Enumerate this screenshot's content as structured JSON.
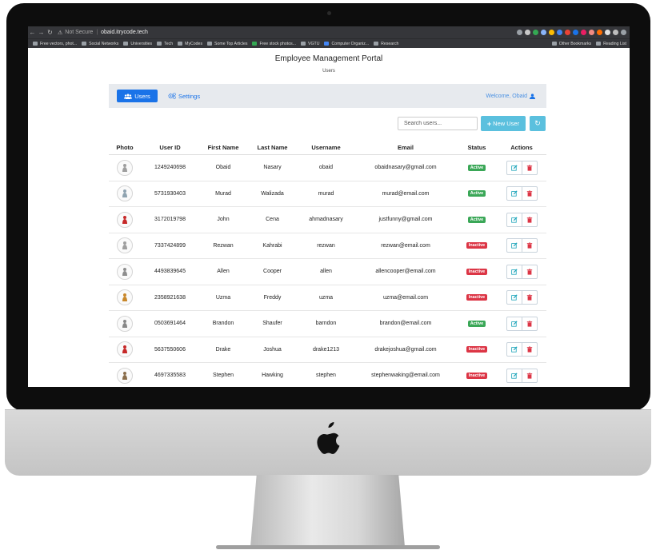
{
  "browser": {
    "not_secure": "Not Secure",
    "url": "obaid.itrycode.tech",
    "bookmarks": [
      "Free vectors, phot...",
      "Social Networks",
      "Universities",
      "Tech",
      "MyCodes",
      "Some Top Articles",
      "Free stock photos...",
      "VGTU",
      "Computer Organiz...",
      "Research"
    ],
    "bookmarks_right": [
      "Other Bookmarks",
      "Reading List"
    ]
  },
  "page": {
    "title": "Employee Management Portal",
    "subtitle": "Users"
  },
  "nav": {
    "users_label": "Users",
    "settings_label": "Settings",
    "welcome": "Welcome, Obaid"
  },
  "toolbar": {
    "search_placeholder": "Search users...",
    "new_user_label": "New User"
  },
  "table": {
    "headers": [
      "Photo",
      "User ID",
      "First Name",
      "Last Name",
      "Username",
      "Email",
      "Status",
      "Actions"
    ],
    "rows": [
      {
        "id": "1249240698",
        "first": "Obaid",
        "last": "Nasary",
        "username": "obaid",
        "email": "obaidnasary@gmail.com",
        "status": "Active"
      },
      {
        "id": "5731930403",
        "first": "Murad",
        "last": "Walizada",
        "username": "murad",
        "email": "murad@email.com",
        "status": "Active"
      },
      {
        "id": "3172019798",
        "first": "John",
        "last": "Cena",
        "username": "ahmadnasary",
        "email": "justfunny@gmail.com",
        "status": "Active"
      },
      {
        "id": "7337424899",
        "first": "Rezwan",
        "last": "Kahrabi",
        "username": "rezwan",
        "email": "rezwan@email.com",
        "status": "Inactive"
      },
      {
        "id": "4493839645",
        "first": "Allen",
        "last": "Cooper",
        "username": "allen",
        "email": "allencooper@email.com",
        "status": "Inactive"
      },
      {
        "id": "2358921638",
        "first": "Uzma",
        "last": "Freddy",
        "username": "uzma",
        "email": "uzma@email.com",
        "status": "Inactive"
      },
      {
        "id": "0503691464",
        "first": "Brandon",
        "last": "Shaufer",
        "username": "barndon",
        "email": "brandon@email.com",
        "status": "Active"
      },
      {
        "id": "5637550606",
        "first": "Drake",
        "last": "Joshua",
        "username": "drake1213",
        "email": "drakejoshua@gmail.com",
        "status": "Inactive"
      },
      {
        "id": "4697335583",
        "first": "Stephen",
        "last": "Hawking",
        "username": "stephen",
        "email": "stephenwaking@email.com",
        "status": "Inactive"
      }
    ]
  },
  "colors": {
    "primary": "#1a73e8",
    "info": "#5bc0de",
    "active": "#3aa757",
    "inactive": "#dc3545"
  }
}
